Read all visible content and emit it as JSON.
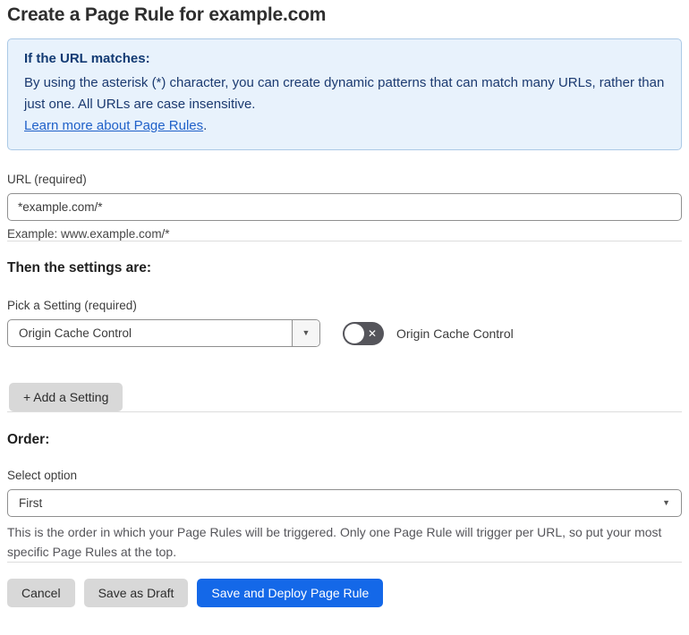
{
  "page": {
    "title": "Create a Page Rule for example.com"
  },
  "info_box": {
    "heading": "If the URL matches:",
    "body": "By using the asterisk (*) character, you can create dynamic patterns that can match many URLs, rather than just one. All URLs are case insensitive.",
    "link_label": "Learn more about Page Rules",
    "link_suffix": "."
  },
  "url_section": {
    "label": "URL (required)",
    "value": "*example.com/*",
    "helper": "Example: www.example.com/*"
  },
  "settings_section": {
    "heading": "Then the settings are:",
    "pick_label": "Pick a Setting (required)",
    "selected_setting": "Origin Cache Control",
    "toggle_state": "off",
    "toggle_label": "Origin Cache Control",
    "add_button_label": "+ Add a Setting"
  },
  "order_section": {
    "heading": "Order:",
    "label": "Select option",
    "selected_option": "First",
    "helper": "This is the order in which your Page Rules will be triggered. Only one Page Rule will trigger per URL, so put your most specific Page Rules at the top."
  },
  "footer": {
    "cancel_label": "Cancel",
    "save_draft_label": "Save as Draft",
    "save_deploy_label": "Save and Deploy Page Rule"
  },
  "icons": {
    "dropdown_caret": "▼",
    "toggle_off_x": "✕"
  },
  "colors": {
    "info_bg": "#e8f2fc",
    "info_border": "#abc9e6",
    "info_text": "#1b3a70",
    "link": "#2061c9",
    "primary_button": "#1468e8",
    "gray_button": "#d8d8d8",
    "toggle_off_bg": "#55555b",
    "divider": "#dddddd"
  }
}
